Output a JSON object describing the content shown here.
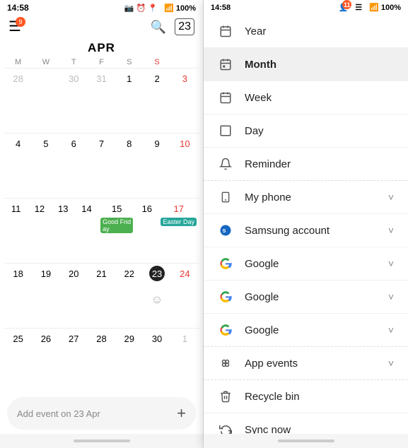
{
  "left": {
    "status": {
      "time": "14:58",
      "icons": "📷 ⏰ 📍"
    },
    "month_title": "APR",
    "day_labels": [
      "M",
      "W",
      "T",
      "F",
      "S",
      "S"
    ],
    "add_event_placeholder": "Add event on 23 Apr",
    "weeks": [
      {
        "days": [
          {
            "num": "28",
            "style": "gray"
          },
          {
            "num": ""
          },
          {
            "num": "30",
            "style": "gray"
          },
          {
            "num": "31",
            "style": "gray"
          },
          {
            "num": "1",
            "style": "normal"
          },
          {
            "num": "2",
            "style": "normal"
          },
          {
            "num": "3",
            "style": "red"
          }
        ]
      },
      {
        "days": [
          {
            "num": "4",
            "style": "normal"
          },
          {
            "num": "5",
            "style": "normal"
          },
          {
            "num": "6",
            "style": "normal"
          },
          {
            "num": "7",
            "style": "normal"
          },
          {
            "num": "8",
            "style": "normal"
          },
          {
            "num": "9",
            "style": "normal"
          },
          {
            "num": "10",
            "style": "red"
          }
        ]
      },
      {
        "days": [
          {
            "num": "11",
            "style": "normal"
          },
          {
            "num": "12",
            "style": "normal"
          },
          {
            "num": "13",
            "style": "normal"
          },
          {
            "num": "14",
            "style": "normal"
          },
          {
            "num": "15",
            "style": "normal",
            "event": "Good Friday",
            "eventColor": "green"
          },
          {
            "num": "16",
            "style": "normal"
          },
          {
            "num": "17",
            "style": "red",
            "event": "Easter Day",
            "eventColor": "teal"
          }
        ]
      },
      {
        "days": [
          {
            "num": "18",
            "style": "normal"
          },
          {
            "num": "19",
            "style": "normal"
          },
          {
            "num": "20",
            "style": "normal"
          },
          {
            "num": "21",
            "style": "normal"
          },
          {
            "num": "22",
            "style": "normal"
          },
          {
            "num": "23",
            "style": "today"
          },
          {
            "num": "24",
            "style": "red"
          }
        ]
      },
      {
        "days": [
          {
            "num": "25",
            "style": "normal"
          },
          {
            "num": "26",
            "style": "normal"
          },
          {
            "num": "27",
            "style": "normal"
          },
          {
            "num": "28",
            "style": "normal"
          },
          {
            "num": "29",
            "style": "normal"
          },
          {
            "num": "30",
            "style": "normal"
          },
          {
            "num": "1",
            "style": "gray"
          }
        ]
      }
    ]
  },
  "right": {
    "status": {
      "time": "14:58"
    },
    "menu_items": [
      {
        "label": "Year",
        "icon": "calendar-year-icon",
        "iconChar": "📅",
        "has_chevron": false,
        "active": false
      },
      {
        "label": "Month",
        "icon": "calendar-month-icon",
        "iconChar": "🗓",
        "has_chevron": false,
        "active": true
      },
      {
        "label": "Week",
        "icon": "calendar-week-icon",
        "iconChar": "📆",
        "has_chevron": false,
        "active": false
      },
      {
        "label": "Day",
        "icon": "calendar-day-icon",
        "iconChar": "📄",
        "has_chevron": false,
        "active": false
      },
      {
        "label": "Reminder",
        "icon": "reminder-icon",
        "iconChar": "🔔",
        "has_chevron": false,
        "active": false,
        "separator": true
      },
      {
        "label": "My phone",
        "icon": "phone-icon",
        "iconChar": "📱",
        "has_chevron": true,
        "active": false
      },
      {
        "label": "Samsung account",
        "icon": "samsung-icon",
        "iconChar": "🔵",
        "has_chevron": true,
        "active": false
      },
      {
        "label": "Google",
        "icon": "google-icon-1",
        "iconChar": "G",
        "has_chevron": true,
        "active": false,
        "isGoogle": true
      },
      {
        "label": "Google",
        "icon": "google-icon-2",
        "iconChar": "G",
        "has_chevron": true,
        "active": false,
        "isGoogle": true
      },
      {
        "label": "Google",
        "icon": "google-icon-3",
        "iconChar": "G",
        "has_chevron": true,
        "active": false,
        "isGoogle": true,
        "separator": true
      },
      {
        "label": "App events",
        "icon": "app-events-icon",
        "iconChar": "⚙",
        "has_chevron": true,
        "active": false,
        "separator": true
      },
      {
        "label": "Recycle bin",
        "icon": "recycle-bin-icon",
        "iconChar": "🗑",
        "has_chevron": false,
        "active": false
      },
      {
        "label": "Sync now",
        "icon": "sync-icon",
        "iconChar": "↻",
        "has_chevron": false,
        "active": false
      }
    ]
  }
}
